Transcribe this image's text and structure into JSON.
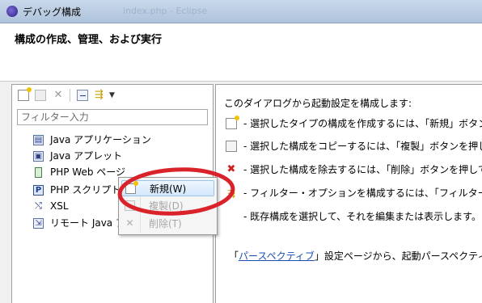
{
  "window": {
    "title": "デバッグ構成",
    "background_title": "index.php - Eclipse"
  },
  "header": {
    "title": "構成の作成、管理、および実行"
  },
  "sidebar": {
    "toolbar_icons": [
      "new-config-icon",
      "duplicate-icon",
      "delete-icon",
      "collapse-all-icon",
      "filter-icon",
      "view-menu-icon"
    ],
    "filter_placeholder": "フィルター入力",
    "items": [
      {
        "label": "Java アプリケーション",
        "icon": "java-application-icon"
      },
      {
        "label": "Java アプレット",
        "icon": "java-applet-icon"
      },
      {
        "label": "PHP Web ページ",
        "icon": "php-web-page-icon"
      },
      {
        "label": "PHP スクリプト",
        "icon": "php-script-icon"
      },
      {
        "label": "XSL",
        "icon": "xsl-icon"
      },
      {
        "label": "リモート Java アプリケーション",
        "icon": "remote-java-icon"
      }
    ]
  },
  "context_menu": {
    "items": [
      {
        "label": "新規(W)",
        "icon": "new-icon",
        "enabled": true,
        "highlighted": true
      },
      {
        "label": "複製(D)",
        "icon": "duplicate-icon",
        "enabled": false
      },
      {
        "label": "削除(T)",
        "icon": "delete-icon",
        "enabled": false
      }
    ]
  },
  "main": {
    "intro": "このダイアログから起動設定を構成します:",
    "bullets": [
      {
        "icon": "new-icon",
        "text": "- 選択したタイプの構成を作成するには、「新規」ボタン"
      },
      {
        "icon": "duplicate-icon",
        "text": "- 選択した構成をコピーするには、「複製」ボタンを押し"
      },
      {
        "icon": "delete-icon",
        "text": "- 選択した構成を除去するには、「削除」ボタンを押して"
      },
      {
        "icon": "filter-icon",
        "text": "- フィルター・オプションを構成するには、「フィルター"
      },
      {
        "icon": "",
        "text": "- 既存構成を選択して、それを編集または表示します。"
      }
    ],
    "footer": {
      "prefix": "「",
      "link": "パースペクティブ",
      "suffix": "」設定ページから、起動パースペクティブ"
    }
  },
  "colors": {
    "annotation": "#d9222a",
    "link": "#1a4fb0",
    "menu_highlight": "#d3e7fb"
  }
}
